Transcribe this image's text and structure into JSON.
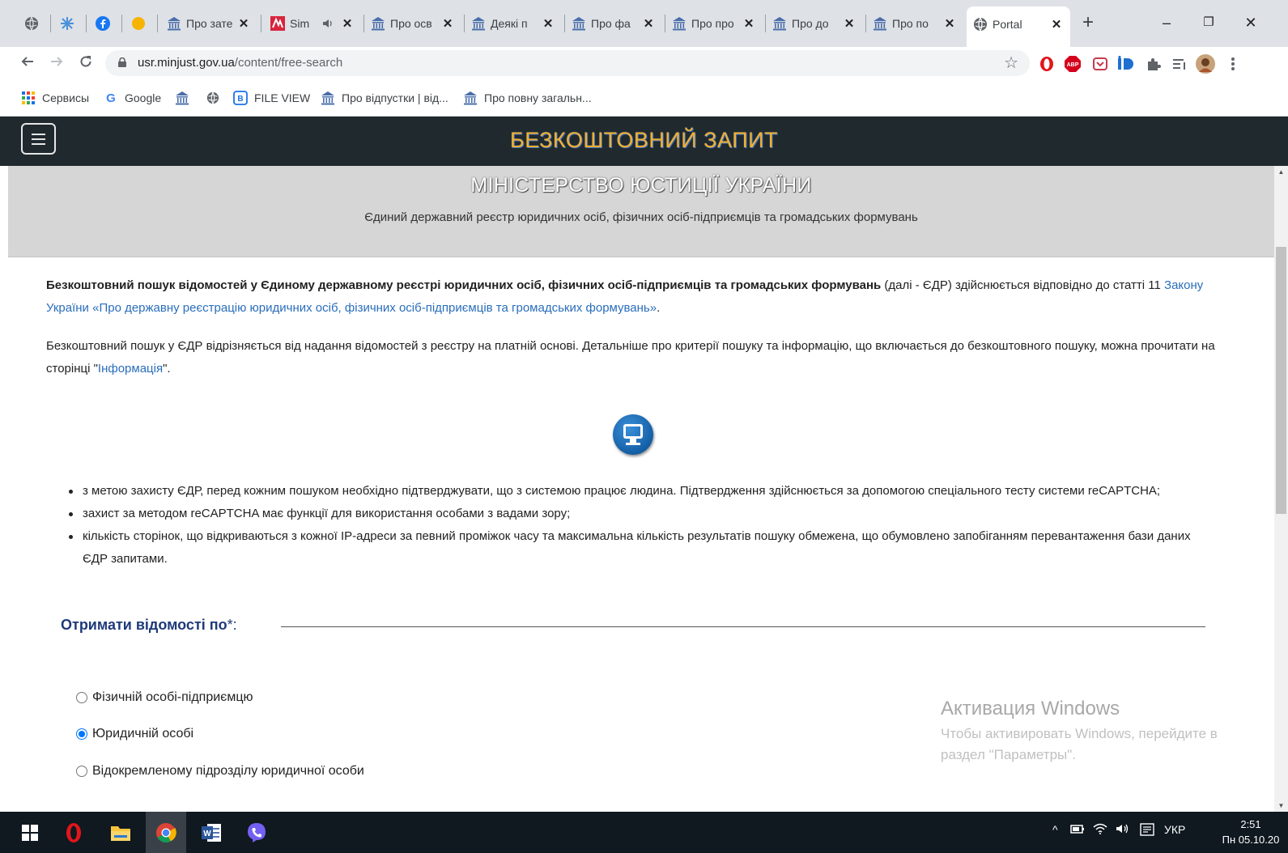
{
  "tabs": [
    {
      "title": "Про зате"
    },
    {
      "title": "Sim"
    },
    {
      "title": "Про осв"
    },
    {
      "title": "Деякі п"
    },
    {
      "title": "Про фа"
    },
    {
      "title": "Про про"
    },
    {
      "title": "Про до"
    },
    {
      "title": "Про по"
    },
    {
      "title": "Portal"
    }
  ],
  "tab_close": "✕",
  "new_tab": "+",
  "window": {
    "minimize": "–",
    "maximize": "❐",
    "close": "✕"
  },
  "address": {
    "host": "usr.minjust.gov.ua",
    "path": "/content/free-search"
  },
  "bookmarks": [
    {
      "label": "Сервисы",
      "icon": "apps-grid-icon"
    },
    {
      "label": "Google",
      "icon": "google-icon"
    },
    {
      "label": "",
      "icon": "gov-building-icon"
    },
    {
      "label": "",
      "icon": "globe-icon"
    },
    {
      "label": "FILE VIEW",
      "icon": "file-view-icon"
    },
    {
      "label": "Про відпустки | від...",
      "icon": "gov-building-icon"
    },
    {
      "label": "Про повну загальн...",
      "icon": "gov-building-icon"
    }
  ],
  "header": {
    "title": "БЕЗКОШТОВНИЙ ЗАПИТ"
  },
  "ministry": {
    "name": "МІНІСТЕРСТВО ЮСТИЦІЇ УКРАЇНИ",
    "registry": "Єдиний державний реєстр юридичних осіб, фізичних осіб-підприємців та громадських формувань"
  },
  "intro": {
    "bold": "Безкоштовний пошук відомостей у Єдиному державному реєстрі юридичних осіб, фізичних осіб-підприємців та громадських формувань",
    "text1": " (далі - ЄДР) здійснюється відповідно до статті 11 ",
    "law_link": "Закону України «Про державну реєстрацію юридичних осіб, фізичних осіб-підприємців та громадських формувань»",
    "text2": "."
  },
  "info": {
    "text1": "Безкоштовний пошук у ЄДР відрізняється від надання відомостей з реєстру на платній основі. Детальніше про критерії пошуку та інформацію, що включається до безкоштовного пошуку, можна прочитати на сторінці \"",
    "link": "Інформація",
    "text2": "\"."
  },
  "bullets": [
    "з метою захисту ЄДР, перед кожним пошуком необхідно підтверджувати, що з системою працює людина. Підтвердження здійснюється за допомогою спеціального тесту системи reCAPTCHA;",
    "захист за методом reCAPTCHA має функції для використання особами з вадами зору;",
    "кількість сторінок, що відкриваються з кожної IP-адреси за певний проміжок часу та максимальна кількість результатів пошуку обмежена, що обумовлено запобіганням перевантаження бази даних ЄДР запитами."
  ],
  "form": {
    "legend": "Отримати відомості по",
    "required_mark": "*:",
    "options": [
      {
        "label": "Фізичній особі-підприємцю",
        "checked": false
      },
      {
        "label": "Юридичній особі",
        "checked": true
      },
      {
        "label": "Відокремленому підрозділу юридичної особи",
        "checked": false
      }
    ]
  },
  "watermark": {
    "title": "Активация Windows",
    "line1": "Чтобы активировать Windows, перейдите в",
    "line2": "раздел \"Параметры\"."
  },
  "taskbar": {
    "language": "УКР",
    "time": "2:51",
    "date": "Пн 05.10.20"
  },
  "colors": {
    "header_bg": "#202a2e",
    "title_gold": "#f0b030",
    "link": "#2a6ebb",
    "legend": "#1f3a7a",
    "radio_checked": "#0075ff"
  }
}
